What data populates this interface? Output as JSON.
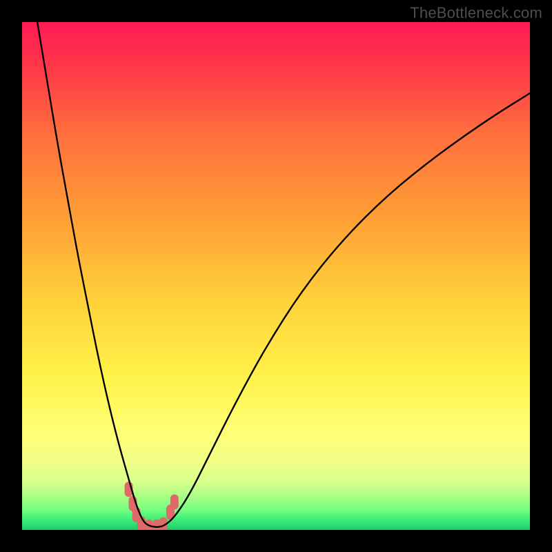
{
  "watermark": {
    "text": "TheBottleneck.com"
  },
  "gradient": {
    "stops": [
      {
        "offset": 0.0,
        "color": "#ff1a54"
      },
      {
        "offset": 0.1,
        "color": "#ff3b47"
      },
      {
        "offset": 0.22,
        "color": "#ff6f3d"
      },
      {
        "offset": 0.38,
        "color": "#ff9d36"
      },
      {
        "offset": 0.55,
        "color": "#ffd23a"
      },
      {
        "offset": 0.7,
        "color": "#fff24a"
      },
      {
        "offset": 0.8,
        "color": "#ffff73"
      },
      {
        "offset": 0.86,
        "color": "#f4ff86"
      },
      {
        "offset": 0.905,
        "color": "#d8ff8c"
      },
      {
        "offset": 0.935,
        "color": "#a8ff86"
      },
      {
        "offset": 0.96,
        "color": "#73ff80"
      },
      {
        "offset": 0.985,
        "color": "#34e777"
      },
      {
        "offset": 1.0,
        "color": "#22c86b"
      }
    ]
  },
  "chart_data": {
    "type": "line",
    "title": "",
    "xlabel": "",
    "ylabel": "",
    "xlim": [
      0,
      100
    ],
    "ylim": [
      0,
      100
    ],
    "series": [
      {
        "name": "bottleneck-curve",
        "x": [
          3,
          5,
          7,
          9,
          11,
          13,
          15,
          17,
          19,
          21,
          22,
          23,
          24,
          25,
          26.5,
          28,
          30,
          33,
          37,
          42,
          48,
          55,
          63,
          72,
          82,
          92,
          100
        ],
        "y": [
          100,
          88,
          76,
          65,
          54,
          44,
          34,
          25,
          17,
          10,
          6.5,
          3.5,
          1.5,
          0.8,
          0.5,
          0.8,
          2.5,
          7,
          15,
          25,
          36,
          47,
          57,
          66,
          74,
          81,
          86
        ]
      }
    ],
    "markers": {
      "name": "curve-highlight-dots",
      "color": "#e06a6a",
      "points": [
        {
          "x": 21.0,
          "y": 8.0
        },
        {
          "x": 21.8,
          "y": 5.2
        },
        {
          "x": 22.5,
          "y": 3.0
        },
        {
          "x": 23.5,
          "y": 1.2
        },
        {
          "x": 25.0,
          "y": 0.6
        },
        {
          "x": 26.5,
          "y": 0.6
        },
        {
          "x": 27.8,
          "y": 1.0
        },
        {
          "x": 29.2,
          "y": 3.5
        },
        {
          "x": 30.0,
          "y": 5.5
        }
      ]
    }
  }
}
